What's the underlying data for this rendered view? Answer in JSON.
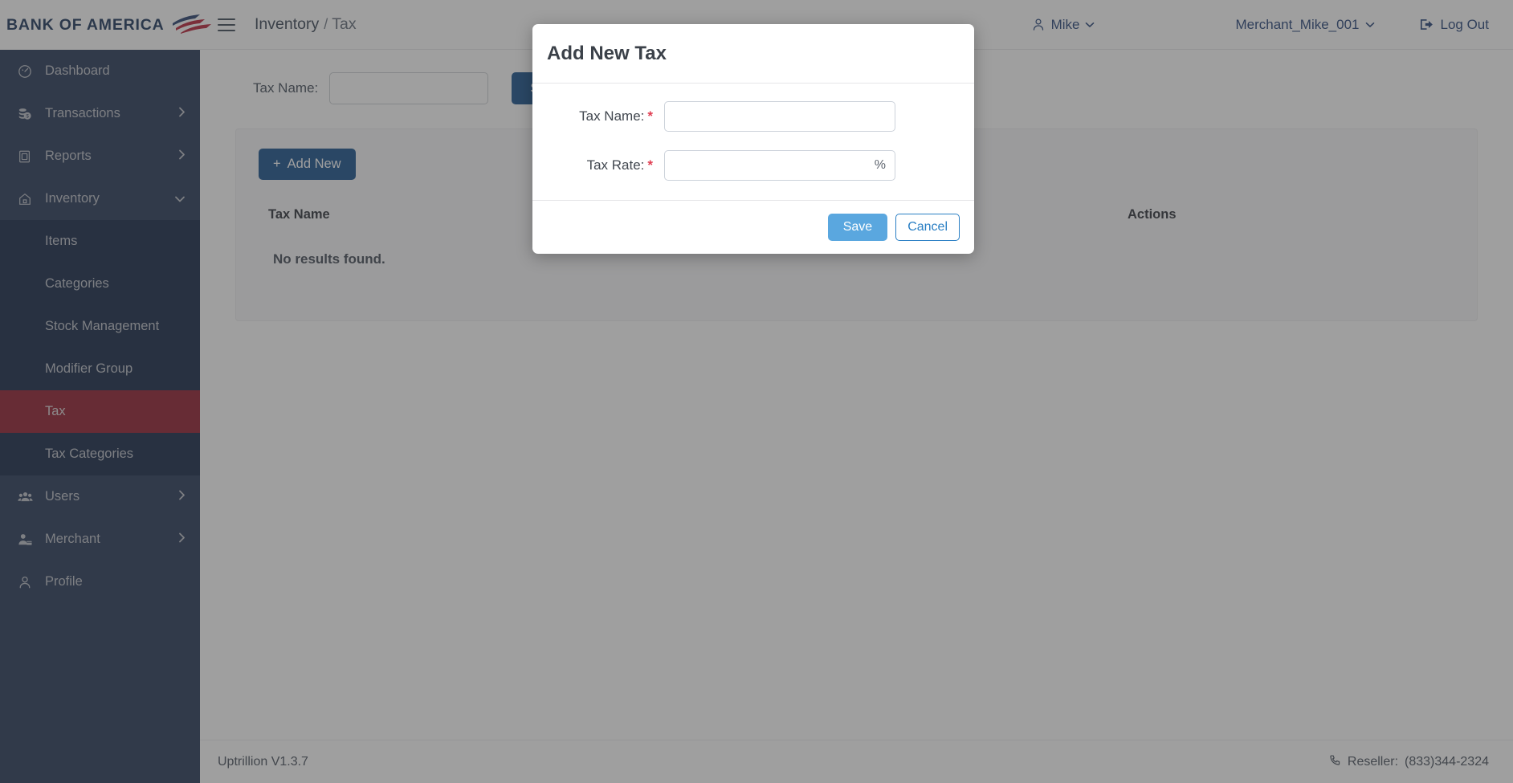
{
  "brand": {
    "name": "BANK OF AMERICA",
    "logo_icon": "bank-of-america-flag-icon"
  },
  "sidebar": {
    "items": [
      {
        "label": "Dashboard",
        "icon": "dashboard-gauge-icon",
        "has_children": false,
        "expanded": false
      },
      {
        "label": "Transactions",
        "icon": "coins-icon",
        "has_children": true,
        "expanded": false,
        "chevron": "›"
      },
      {
        "label": "Reports",
        "icon": "report-document-icon",
        "has_children": true,
        "expanded": false,
        "chevron": "›"
      },
      {
        "label": "Inventory",
        "icon": "home-box-icon",
        "has_children": true,
        "expanded": true,
        "chevron": "⌄"
      },
      {
        "label": "Users",
        "icon": "users-group-icon",
        "has_children": true,
        "expanded": false,
        "chevron": "›"
      },
      {
        "label": "Merchant",
        "icon": "merchant-person-icon",
        "has_children": true,
        "expanded": false,
        "chevron": "›"
      },
      {
        "label": "Profile",
        "icon": "profile-person-icon",
        "has_children": false,
        "expanded": false
      }
    ],
    "inventory_submenu": [
      {
        "label": "Items",
        "active": false
      },
      {
        "label": "Categories",
        "active": false
      },
      {
        "label": "Stock Management",
        "active": false
      },
      {
        "label": "Modifier Group",
        "active": false
      },
      {
        "label": "Tax",
        "active": true
      },
      {
        "label": "Tax Categories",
        "active": false
      }
    ],
    "active_color": "#8b1022",
    "background_color": "#1b2d4f",
    "submenu_background_color": "#071a3c"
  },
  "header": {
    "menu_toggle_icon": "hamburger-menu-icon",
    "breadcrumb": {
      "parent": "Inventory",
      "separator": "/",
      "current": "Tax"
    },
    "user_menu": {
      "label": "Mike",
      "icon": "user-icon",
      "caret": "⌄"
    },
    "merchant_menu": {
      "label": "Merchant_Mike_001",
      "caret": "⌄"
    },
    "logout": {
      "label": "Log Out",
      "icon": "logout-icon"
    }
  },
  "main": {
    "search": {
      "label": "Tax Name:",
      "value": "",
      "placeholder": "",
      "button_label": "Search"
    },
    "add_new_button": {
      "label": "Add New",
      "plus": "+"
    },
    "table": {
      "columns": [
        "Tax Name",
        "Actions"
      ],
      "rows": [],
      "empty_message": "No results found."
    }
  },
  "footer": {
    "version": "Uptrillion V1.3.7",
    "reseller_label": "Reseller:",
    "reseller_phone": "(833)344-2324",
    "phone_icon": "phone-icon"
  },
  "modal": {
    "title": "Add New Tax",
    "fields": [
      {
        "label": "Tax Name:",
        "required_mark": "*",
        "value": "",
        "placeholder": "",
        "suffix": ""
      },
      {
        "label": "Tax Rate:",
        "required_mark": "*",
        "value": "",
        "placeholder": "",
        "suffix": "%"
      }
    ],
    "save_label": "Save",
    "cancel_label": "Cancel",
    "save_color": "#5aa7df",
    "cancel_color": "#2a7fc4"
  }
}
